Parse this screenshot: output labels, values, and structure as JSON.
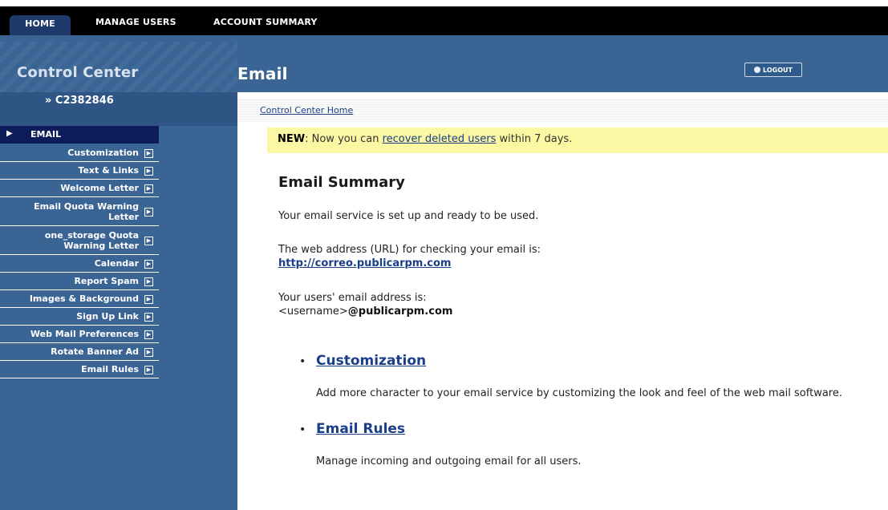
{
  "top_nav": {
    "tabs": [
      {
        "label": "HOME",
        "active": true
      },
      {
        "label": "MANAGE USERS",
        "active": false
      },
      {
        "label": "ACCOUNT SUMMARY",
        "active": false
      }
    ]
  },
  "header": {
    "control_center": "Control Center",
    "page_title": "Email",
    "logout_label": "LOGOUT"
  },
  "account": {
    "id": "» C2382846"
  },
  "breadcrumb": {
    "label": "Control Center Home"
  },
  "notice": {
    "new_label": "NEW",
    "text_before": ": Now you can ",
    "link": "recover deleted users",
    "text_after": " within 7 days."
  },
  "sidebar": {
    "section": "EMAIL",
    "items": [
      {
        "label": "Customization"
      },
      {
        "label": "Text & Links"
      },
      {
        "label": "Welcome Letter"
      },
      {
        "label": "Email Quota Warning Letter",
        "line1": "Email Quota Warning",
        "line2": "Letter"
      },
      {
        "label": "one_storage Quota Warning Letter",
        "line1": "one_storage Quota",
        "line2": "Warning Letter"
      },
      {
        "label": "Calendar"
      },
      {
        "label": "Report Spam"
      },
      {
        "label": "Images & Background"
      },
      {
        "label": "Sign Up Link"
      },
      {
        "label": "Web Mail Preferences"
      },
      {
        "label": "Rotate Banner Ad"
      },
      {
        "label": "Email Rules"
      }
    ]
  },
  "main": {
    "heading": "Email Summary",
    "ready_text": "Your email service is set up and ready to be used.",
    "web_address_text": "The web address (URL) for checking your email is:",
    "web_url": "http://correo.publicarpm.com",
    "address_text": "Your users' email address is:",
    "username_placeholder": "<username>",
    "domain": "@publicarpm.com",
    "links": [
      {
        "title": "Customization",
        "description": "Add more character to your email service by customizing the look and feel of the web mail software."
      },
      {
        "title": "Email Rules",
        "description": "Manage incoming and outgoing email for all users."
      }
    ]
  },
  "colors": {
    "top_nav_bg": "#000000",
    "active_tab_bg": "#1e3a6a",
    "header_blue": "#3a6494",
    "menu_head_bg": "#0d1d5c",
    "notice_bg": "#fbf7a3",
    "link": "#1a3f8a"
  },
  "icons": {
    "menu_arrow": "triangle-right-icon",
    "menu_item": "chevron-right-box-icon",
    "logout": "logout-icon"
  }
}
